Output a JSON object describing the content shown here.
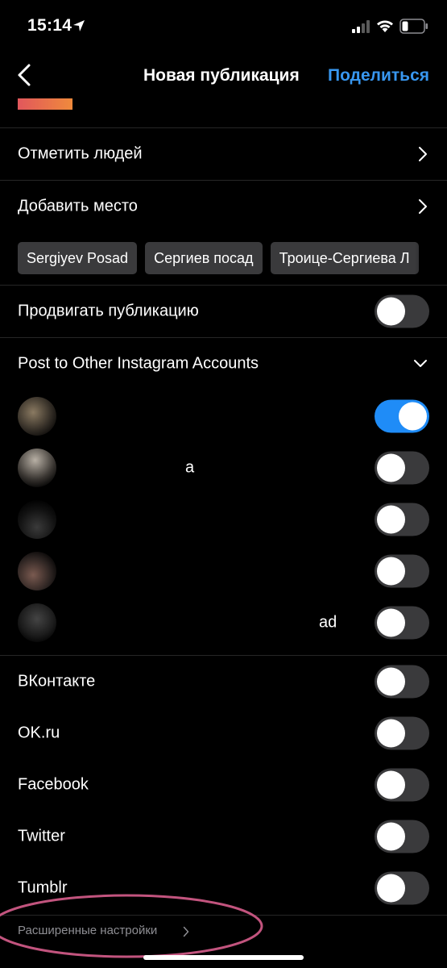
{
  "status_bar": {
    "time": "15:14"
  },
  "nav": {
    "title": "Новая публикация",
    "share_label": "Поделиться"
  },
  "rows": {
    "tag_people": "Отметить людей",
    "add_location": "Добавить место",
    "promote": "Продвигать публикацию",
    "other_accounts": "Post to Other Instagram Accounts"
  },
  "location_suggestions": [
    "Sergiyev Posad",
    "Сергиев посад",
    "Троице-Сергиева Л"
  ],
  "accounts": [
    {
      "name_fragment": "",
      "enabled": true
    },
    {
      "name_fragment": "a",
      "enabled": false
    },
    {
      "name_fragment": "",
      "enabled": false
    },
    {
      "name_fragment": "",
      "enabled": false
    },
    {
      "name_fragment": "ad",
      "enabled": false
    }
  ],
  "share_targets": [
    {
      "label": "ВКонтакте",
      "enabled": false
    },
    {
      "label": "OK.ru",
      "enabled": false
    },
    {
      "label": "Facebook",
      "enabled": false
    },
    {
      "label": "Twitter",
      "enabled": false
    },
    {
      "label": "Tumblr",
      "enabled": false
    }
  ],
  "advanced_settings": "Расширенные настройки",
  "colors": {
    "accent": "#3897f0",
    "toggle_on": "#1f8cf7",
    "toggle_off": "#3a3a3c",
    "highlight": "#c2547e"
  }
}
